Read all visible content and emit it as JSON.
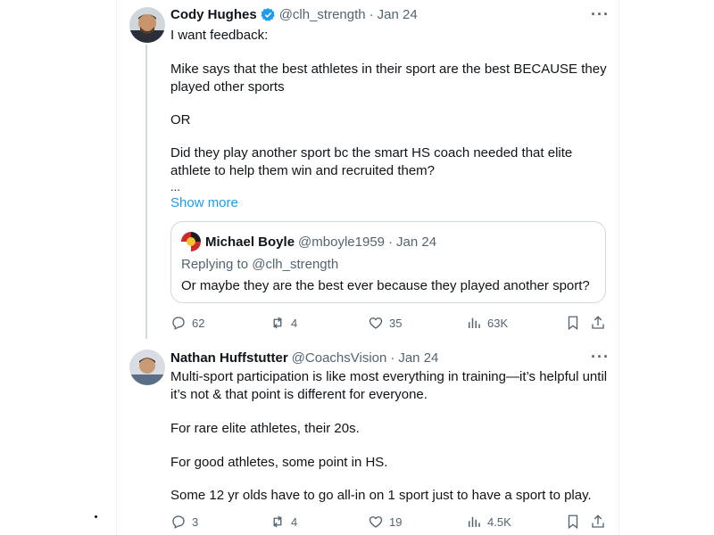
{
  "tweet1": {
    "name": "Cody Hughes",
    "handle": "@clh_strength",
    "sep": "·",
    "date": "Jan 24",
    "more": "···",
    "lines": [
      "I want feedback:",
      "Mike says that the best athletes in their sport are the best BECAUSE they",
      "played other sports",
      "OR",
      "Did they play another sport bc the smart HS coach needed that elite",
      "athlete to help them win and recruited them?",
      "..."
    ],
    "show_more": "Show more",
    "quote": {
      "name": "Michael Boyle",
      "handle": "@mboyle1959",
      "sep": "·",
      "date": "Jan 24",
      "replying": "Replying to @clh_strength",
      "text": "Or maybe they are the best ever because they played another sport?"
    },
    "actions": {
      "replies": "62",
      "reposts": "4",
      "likes": "35",
      "views": "63K"
    }
  },
  "tweet2": {
    "name": "Nathan Huffstutter",
    "handle": "@CoachsVision",
    "sep": "·",
    "date": "Jan 24",
    "more": "···",
    "lines": [
      "Multi-sport participation is like most everything in training—it’s helpful until",
      "it’s not & that point is different for everyone.",
      "For rare elite athletes, their 20s.",
      "For good athletes, some point in HS.",
      "Some 12 yr olds have to go all-in on 1 sport just to have a sport to play."
    ],
    "actions": {
      "replies": "3",
      "reposts": "4",
      "likes": "19",
      "views": "4.5K"
    }
  },
  "colors": {
    "accent": "#1d9bf0",
    "secondary": "#536471",
    "border": "#cfd9de"
  }
}
